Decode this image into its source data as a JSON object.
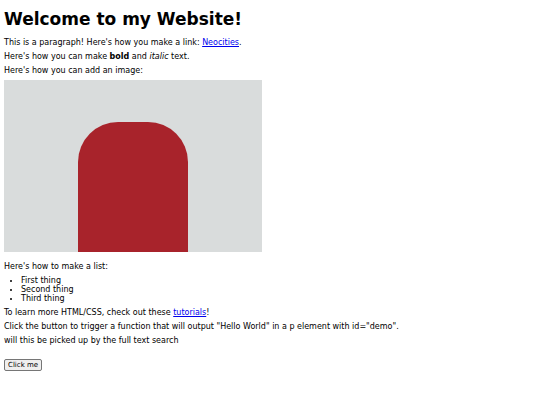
{
  "page": {
    "heading": "Welcome to my Website!",
    "blocks": [
      {
        "kind": "paragraph",
        "parts": [
          {
            "text": "This is a paragraph! Here's how you make a link: ",
            "style": "plain"
          },
          {
            "text": "Neocities",
            "style": "link"
          },
          {
            "text": ".",
            "style": "plain"
          }
        ]
      },
      {
        "kind": "paragraph",
        "parts": [
          {
            "text": "Here's how you can make ",
            "style": "plain"
          },
          {
            "text": "bold",
            "style": "bold"
          },
          {
            "text": " and ",
            "style": "plain"
          },
          {
            "text": "italic",
            "style": "italic"
          },
          {
            "text": " text.",
            "style": "plain"
          }
        ]
      },
      {
        "kind": "paragraph",
        "parts": [
          {
            "text": "Here's how you can add an image:",
            "style": "plain"
          }
        ]
      },
      {
        "kind": "image"
      },
      {
        "kind": "paragraph",
        "parts": [
          {
            "text": "Here's how to make a list:",
            "style": "plain"
          }
        ]
      },
      {
        "kind": "list",
        "items": [
          "First thing",
          "Second thing",
          "Third thing"
        ]
      },
      {
        "kind": "paragraph",
        "parts": [
          {
            "text": "To learn more HTML/CSS, check out these ",
            "style": "plain"
          },
          {
            "text": "tutorials",
            "style": "link"
          },
          {
            "text": "!",
            "style": "plain"
          }
        ]
      },
      {
        "kind": "paragraph",
        "parts": [
          {
            "text": "Click the button to trigger a function that will output \"Hello World\" in a p element with id=\"demo\".",
            "style": "plain"
          }
        ]
      },
      {
        "kind": "paragraph",
        "parts": [
          {
            "text": "will this be picked up by the full text search",
            "style": "plain"
          }
        ]
      },
      {
        "kind": "button",
        "label": "Click me"
      }
    ]
  }
}
